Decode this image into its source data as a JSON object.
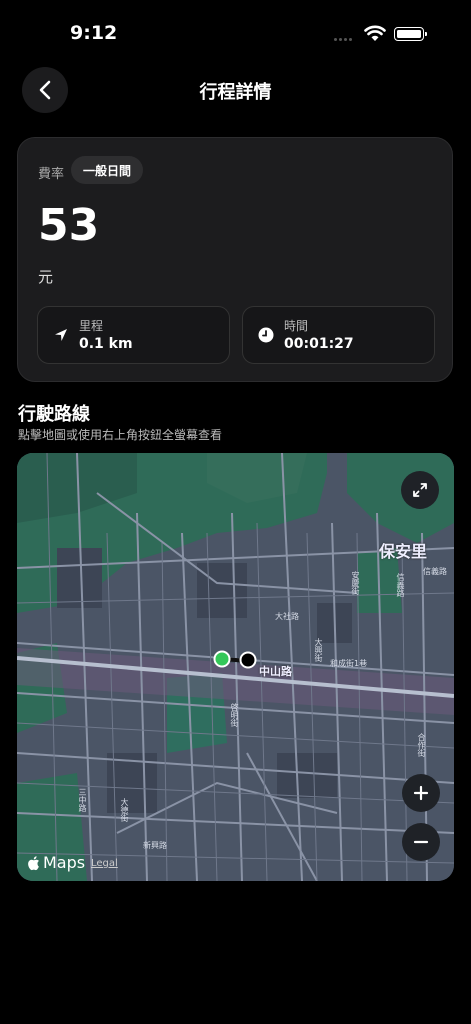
{
  "status_bar": {
    "time": "9:12"
  },
  "header": {
    "title": "行程詳情"
  },
  "fare": {
    "rate_label": "費率",
    "rate_type": "一般日間",
    "amount": "53",
    "unit": "元",
    "distance_label": "里程",
    "distance_value": "0.1 km",
    "duration_label": "時間",
    "duration_value": "00:01:27"
  },
  "route": {
    "title": "行駛路線",
    "subtitle": "點擊地圖或使用右上角按鈕全螢幕查看"
  },
  "map": {
    "district_label": "保安里",
    "road_label": "中山路",
    "street_labels": [
      "大社路",
      "大興街",
      "和成街1巷",
      "信義路",
      "三中路",
      "大德街",
      "新興路",
      "啓明街",
      "安慶街",
      "信義路",
      "合作街"
    ],
    "brand": "Maps",
    "legal": "Legal",
    "start_marker_color": "#34c759",
    "end_marker_color": "#000000"
  }
}
